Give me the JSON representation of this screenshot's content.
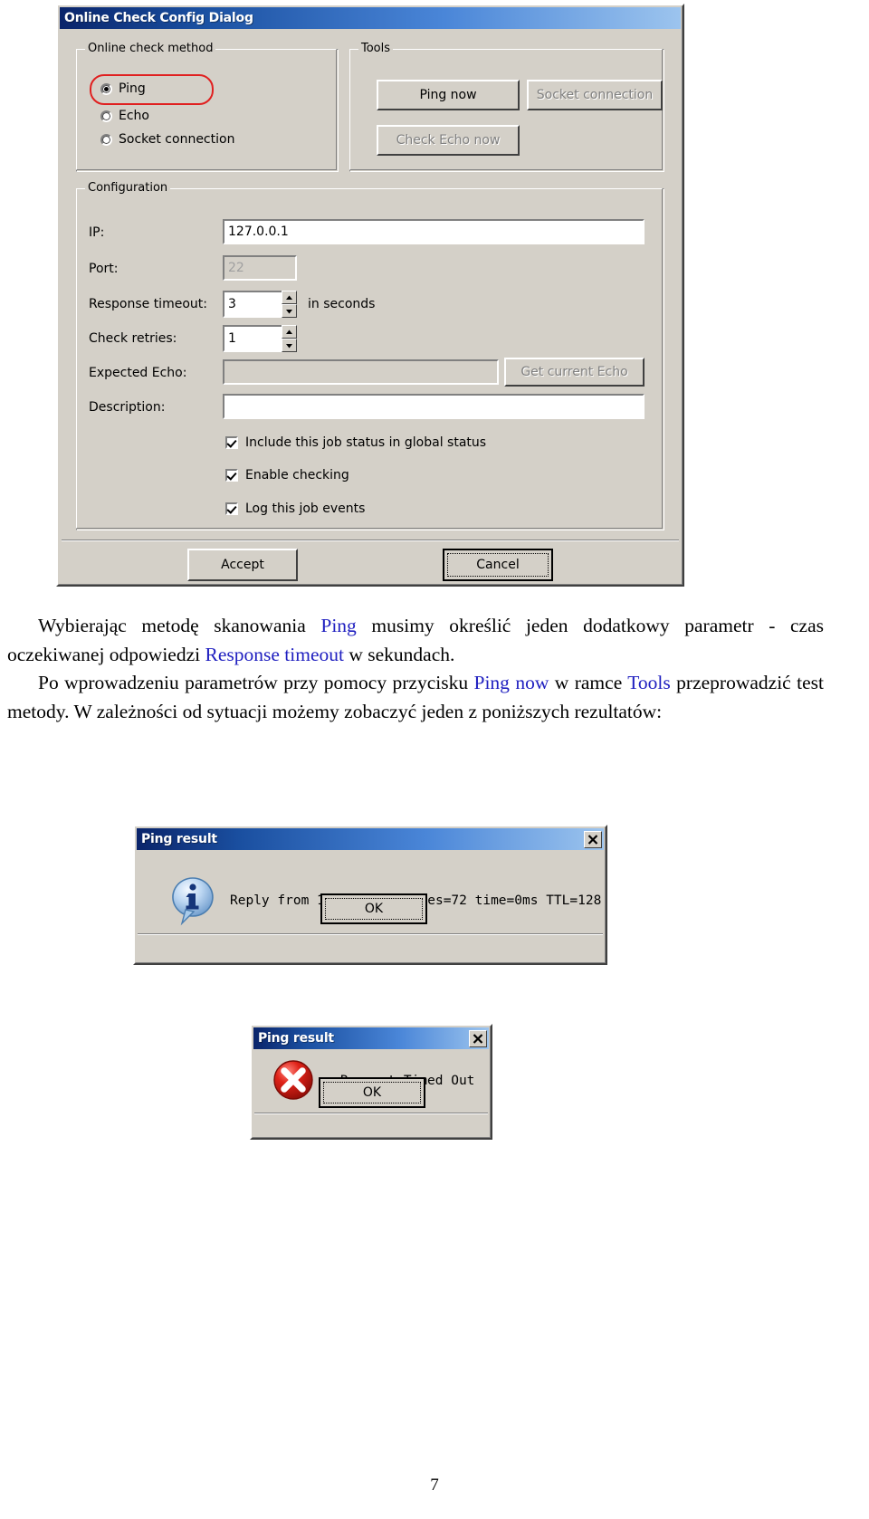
{
  "config_dialog": {
    "title": "Online Check Config Dialog",
    "method_group": {
      "label": "Online check method",
      "options": [
        {
          "label": "Ping",
          "selected": true
        },
        {
          "label": "Echo",
          "selected": false
        },
        {
          "label": "Socket connection",
          "selected": false
        }
      ]
    },
    "tools_group": {
      "label": "Tools",
      "buttons": [
        {
          "label": "Ping now",
          "enabled": true
        },
        {
          "label": "Socket connection",
          "enabled": false
        },
        {
          "label": "Check Echo now",
          "enabled": false
        }
      ]
    },
    "configuration_group": {
      "label": "Configuration",
      "fields": [
        {
          "label": "IP:",
          "value": "127.0.0.1"
        },
        {
          "label": "Port:",
          "value": "22"
        },
        {
          "label": "Response timeout:",
          "value": "3",
          "suffix": "in seconds"
        },
        {
          "label": "Check retries:",
          "value": "1"
        },
        {
          "label": "Expected Echo:",
          "value": ""
        },
        {
          "label": "Description:",
          "value": ""
        }
      ],
      "get_echo_button": "Get current Echo",
      "checkboxes": [
        {
          "label": "Include this job status in global status",
          "checked": true
        },
        {
          "label": "Enable checking",
          "checked": true
        },
        {
          "label": "Log this job events",
          "checked": true
        }
      ]
    },
    "accept_button": "Accept",
    "cancel_button": "Cancel"
  },
  "prose": {
    "para1": {
      "seg1": "Wybierając metodę skanowania ",
      "kw1": "Ping",
      "seg2": " musimy określić jeden dodatkowy parametr - czas oczekiwanej odpowiedzi ",
      "kw2": "Response timeout",
      "seg3": " w sekundach."
    },
    "para2": {
      "seg1": "Po wprowadzeniu parametrów przy pomocy przycisku ",
      "kw1": "Ping now",
      "seg2": " w ramce ",
      "kw2": "Tools",
      "seg3": " przeprowadzić test metody. W zależności od sytuacji możemy zobaczyć jeden z poniższych rezultatów:"
    }
  },
  "ping_success_dialog": {
    "title": "Ping result",
    "icon": "info-icon",
    "message": "Reply from 127.0.0.1: bytes=72 time=0ms TTL=128",
    "ok_button": "OK"
  },
  "ping_timeout_dialog": {
    "title": "Ping result",
    "icon": "error-icon",
    "message": "Request Timed Out",
    "ok_button": "OK"
  },
  "page_number": "7",
  "colors": {
    "dialog_face": "#d4d0c8",
    "titlebar_start": "#0a246a",
    "titlebar_end": "#9cc4ee",
    "keyword": "#2020c0",
    "highlight_oval": "#e02020",
    "error_red": "#cc1414",
    "info_blue": "#1a4fa0"
  }
}
